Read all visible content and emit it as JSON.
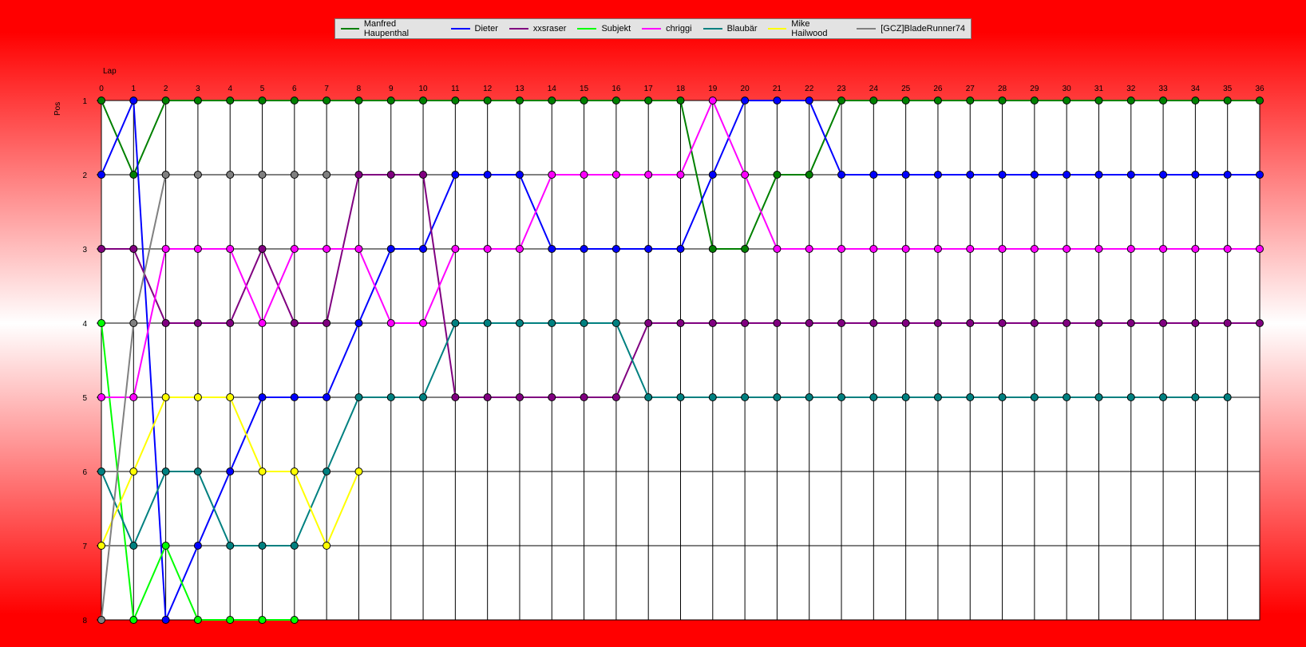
{
  "chart_data": {
    "type": "line",
    "xlabel": "Lap",
    "ylabel": "Pos",
    "xlim": [
      0,
      36
    ],
    "ylim": [
      1,
      8
    ],
    "x_inverted": false,
    "y_inverted": true,
    "grid": true,
    "legend_position": "top-center",
    "x_ticks": [
      0,
      1,
      2,
      3,
      4,
      5,
      6,
      7,
      8,
      9,
      10,
      11,
      12,
      13,
      14,
      15,
      16,
      17,
      18,
      19,
      20,
      21,
      22,
      23,
      24,
      25,
      26,
      27,
      28,
      29,
      30,
      31,
      32,
      33,
      34,
      35,
      36
    ],
    "y_ticks": [
      1,
      2,
      3,
      4,
      5,
      6,
      7,
      8
    ],
    "series": [
      {
        "name": "Manfred Haupenthal",
        "color": "#008000",
        "x": [
          0,
          1,
          2,
          3,
          4,
          5,
          6,
          7,
          8,
          9,
          10,
          11,
          12,
          13,
          14,
          15,
          16,
          17,
          18,
          19,
          20,
          21,
          22,
          23,
          24,
          25,
          26,
          27,
          28,
          29,
          30,
          31,
          32,
          33,
          34,
          35,
          36
        ],
        "values": [
          1,
          2,
          1,
          1,
          1,
          1,
          1,
          1,
          1,
          1,
          1,
          1,
          1,
          1,
          1,
          1,
          1,
          1,
          1,
          3,
          3,
          2,
          2,
          1,
          1,
          1,
          1,
          1,
          1,
          1,
          1,
          1,
          1,
          1,
          1,
          1,
          1
        ]
      },
      {
        "name": "Dieter",
        "color": "#0000ff",
        "x": [
          0,
          1,
          2,
          3,
          4,
          5,
          6,
          7,
          8,
          9,
          10,
          11,
          12,
          13,
          14,
          15,
          16,
          17,
          18,
          19,
          20,
          21,
          22,
          23,
          24,
          25,
          26,
          27,
          28,
          29,
          30,
          31,
          32,
          33,
          34,
          35,
          36
        ],
        "values": [
          2,
          1,
          8,
          7,
          6,
          5,
          5,
          5,
          4,
          3,
          3,
          2,
          2,
          2,
          3,
          3,
          3,
          3,
          3,
          2,
          1,
          1,
          1,
          2,
          2,
          2,
          2,
          2,
          2,
          2,
          2,
          2,
          2,
          2,
          2,
          2,
          2
        ]
      },
      {
        "name": "xxsraser",
        "color": "#800080",
        "x": [
          0,
          1,
          2,
          3,
          4,
          5,
          6,
          7,
          8,
          9,
          10,
          11,
          12,
          13,
          14,
          15,
          16,
          17,
          18,
          19,
          20,
          21,
          22,
          23,
          24,
          25,
          26,
          27,
          28,
          29,
          30,
          31,
          32,
          33,
          34,
          35,
          36
        ],
        "values": [
          3,
          3,
          4,
          4,
          4,
          3,
          4,
          4,
          2,
          2,
          2,
          5,
          5,
          5,
          5,
          5,
          5,
          4,
          4,
          4,
          4,
          4,
          4,
          4,
          4,
          4,
          4,
          4,
          4,
          4,
          4,
          4,
          4,
          4,
          4,
          4,
          4
        ]
      },
      {
        "name": "Subjekt",
        "color": "#00ff00",
        "x": [
          0,
          1,
          2,
          3,
          4,
          5,
          6
        ],
        "values": [
          4,
          8,
          7,
          8,
          8,
          8,
          8
        ]
      },
      {
        "name": "chriggi",
        "color": "#ff00ff",
        "x": [
          0,
          1,
          2,
          3,
          4,
          5,
          6,
          7,
          8,
          9,
          10,
          11,
          12,
          13,
          14,
          15,
          16,
          17,
          18,
          19,
          20,
          21,
          22,
          23,
          24,
          25,
          26,
          27,
          28,
          29,
          30,
          31,
          32,
          33,
          34,
          35,
          36
        ],
        "values": [
          5,
          5,
          3,
          3,
          3,
          4,
          3,
          3,
          3,
          4,
          4,
          3,
          3,
          3,
          2,
          2,
          2,
          2,
          2,
          1,
          2,
          3,
          3,
          3,
          3,
          3,
          3,
          3,
          3,
          3,
          3,
          3,
          3,
          3,
          3,
          3,
          3
        ]
      },
      {
        "name": "Blaubär",
        "color": "#008080",
        "x": [
          0,
          1,
          2,
          3,
          4,
          5,
          6,
          7,
          8,
          9,
          10,
          11,
          12,
          13,
          14,
          15,
          16,
          17,
          18,
          19,
          20,
          21,
          22,
          23,
          24,
          25,
          26,
          27,
          28,
          29,
          30,
          31,
          32,
          33,
          34,
          35
        ],
        "values": [
          6,
          7,
          6,
          6,
          7,
          7,
          7,
          6,
          5,
          5,
          5,
          4,
          4,
          4,
          4,
          4,
          4,
          5,
          5,
          5,
          5,
          5,
          5,
          5,
          5,
          5,
          5,
          5,
          5,
          5,
          5,
          5,
          5,
          5,
          5,
          5
        ]
      },
      {
        "name": "Mike Hailwood",
        "color": "#ffff00",
        "x": [
          0,
          1,
          2,
          3,
          4,
          5,
          6,
          7,
          8
        ],
        "values": [
          7,
          6,
          5,
          5,
          5,
          6,
          6,
          7,
          6
        ]
      },
      {
        "name": "[GCZ]BladeRunner74",
        "color": "#808080",
        "x": [
          0,
          1,
          2,
          3,
          4,
          5,
          6,
          7
        ],
        "values": [
          8,
          4,
          2,
          2,
          2,
          2,
          2,
          2
        ]
      }
    ]
  }
}
